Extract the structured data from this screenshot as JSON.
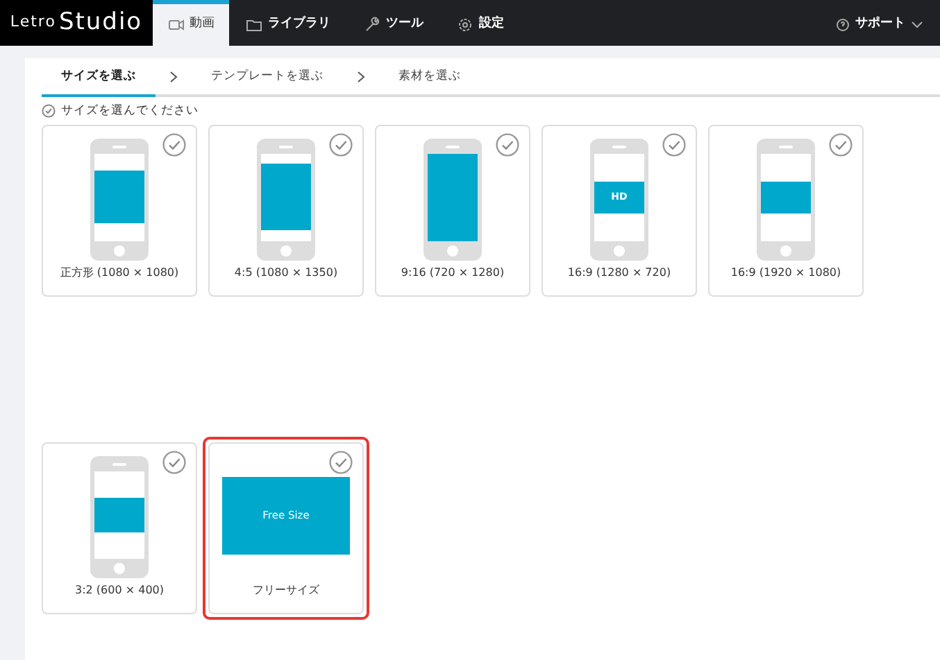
{
  "app": {
    "logo_prefix": "Letro",
    "logo_main": "Studio"
  },
  "nav": [
    {
      "label": "動画",
      "selected": true
    },
    {
      "label": "ライブラリ",
      "selected": false
    },
    {
      "label": "ツール",
      "selected": false
    },
    {
      "label": "設定",
      "selected": false
    }
  ],
  "support": {
    "label": "サポート"
  },
  "steps": [
    {
      "label": "サイズを選ぶ",
      "selected": true
    },
    {
      "label": "テンプレートを選ぶ",
      "selected": false
    },
    {
      "label": "素材を選ぶ",
      "selected": false
    }
  ],
  "hint": "サイズを選んでください",
  "sizes": [
    {
      "kind": "square",
      "caption": "正方形 (1080 × 1080)",
      "selected": false
    },
    {
      "kind": "portrait",
      "caption": "4:5 (1080 × 1350)",
      "selected": false
    },
    {
      "kind": "tall",
      "caption": "9:16 (720 × 1280)",
      "selected": false
    },
    {
      "kind": "wide",
      "caption": "16:9 (1280 × 720)",
      "screen_label": "HD",
      "selected": false
    },
    {
      "kind": "wide",
      "caption": "16:9 (1920 × 1080)",
      "selected": false
    },
    {
      "kind": "landscape",
      "caption": "3:2 (600 × 400)",
      "selected": false
    },
    {
      "kind": "free",
      "caption": "フリーサイズ",
      "screen_label": "Free Size",
      "selected": true
    }
  ]
}
